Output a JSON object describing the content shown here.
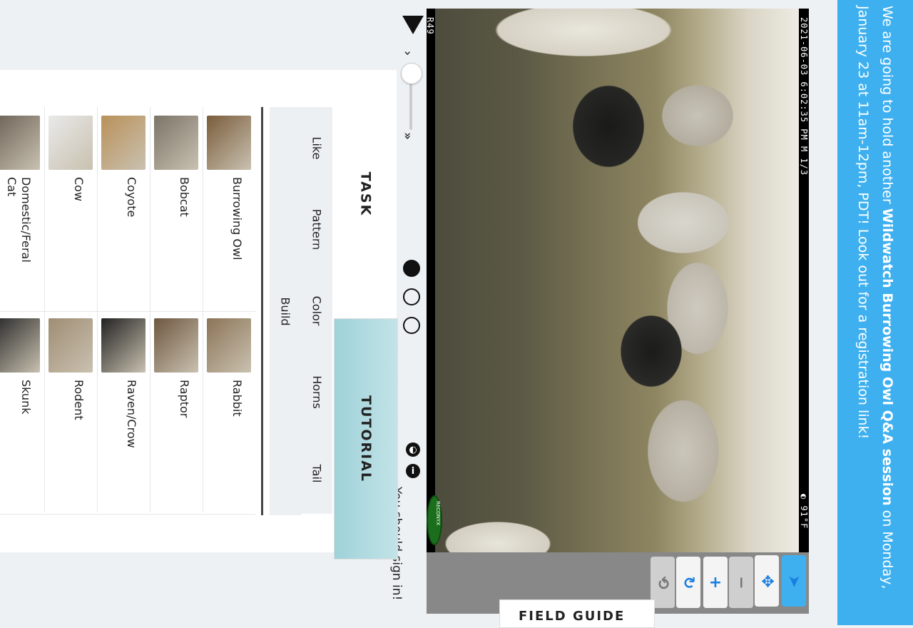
{
  "banner": {
    "pre": "We are going to hold another ",
    "bold": "Wildwatch Burrowing Owl Q&A session",
    "post": " on Monday, January 23 at 11am-12pm, PDT! Look out for a registration link!"
  },
  "subject": {
    "timestamp": "2021-06-03  6:02:35 PM  M 1/3",
    "temperature": "◐  91°F",
    "camera_id": "R49",
    "watermark": "RECONYX"
  },
  "toolbar": {
    "move_icon": "move-icon",
    "pointer_icon": "pointer-icon",
    "zoom_out_icon": "zoom-out-icon",
    "zoom_in_icon": "zoom-in-icon",
    "rotate_icon": "rotate-icon",
    "reset_icon": "reset-icon"
  },
  "field_guide": {
    "label": "FIELD GUIDE"
  },
  "playback": {
    "speed_slower": "›",
    "speed_faster": "»",
    "speed_level": 0.15,
    "frames": 3,
    "current_frame": 1
  },
  "metadata": {
    "signin": "You should sign in!"
  },
  "tabs": {
    "task": "TASK",
    "tutorial": "TUTORIAL"
  },
  "filters": {
    "build": "Build",
    "items": [
      "Like",
      "Pattern",
      "Color",
      "Horns",
      "Tail"
    ]
  },
  "choices": [
    {
      "label": "Burrowing Owl",
      "color": "#7a5d3c"
    },
    {
      "label": "Bobcat",
      "color": "#7b7468"
    },
    {
      "label": "Coyote",
      "color": "#b9915a"
    },
    {
      "label": "Cow",
      "color": "#e9e9e9"
    },
    {
      "label": "Domestic/Feral Cat",
      "color": "#6d6358"
    },
    {
      "label": "Rabbit",
      "color": "#8c7457"
    },
    {
      "label": "Raptor",
      "color": "#6e5740"
    },
    {
      "label": "Raven/Crow",
      "color": "#222222"
    },
    {
      "label": "Rodent",
      "color": "#a08d74"
    },
    {
      "label": "Skunk",
      "color": "#2b2b2b"
    }
  ]
}
